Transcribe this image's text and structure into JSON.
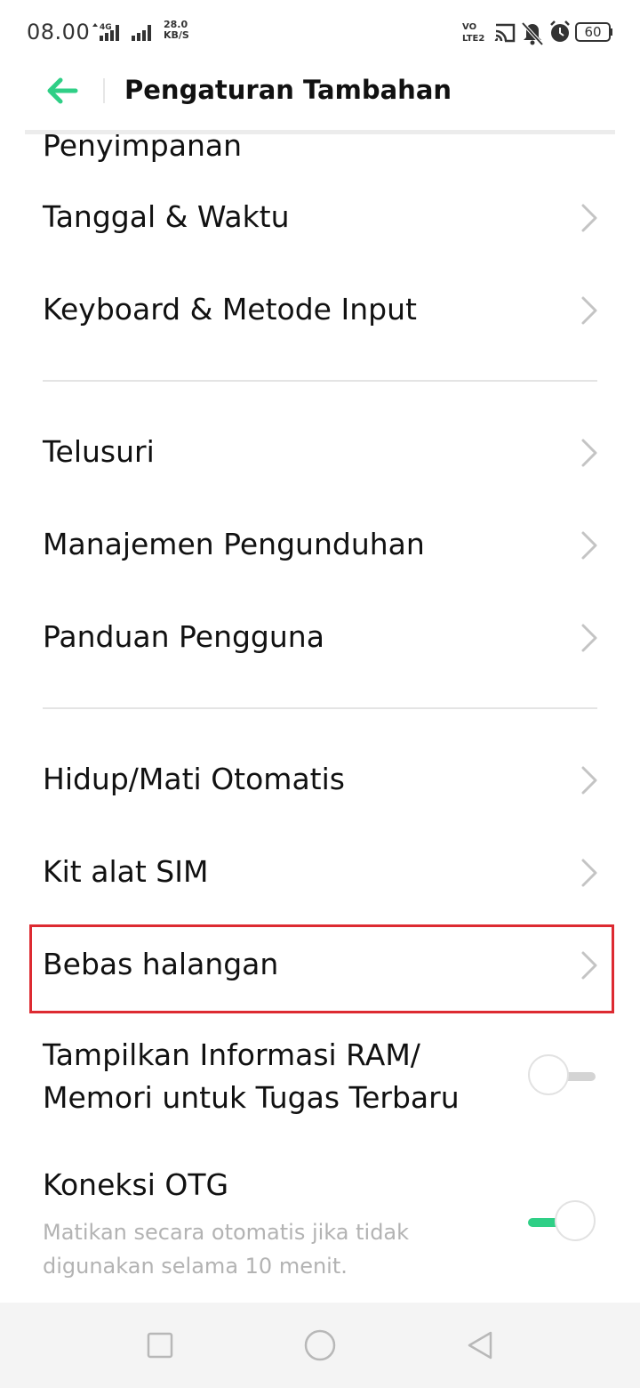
{
  "status_bar": {
    "time": "08.00",
    "network_type": "4G",
    "net_speed_value": "28.0",
    "net_speed_unit": "KB/S",
    "volte_label": "VO\nLTE2",
    "battery_level": "60"
  },
  "header": {
    "title": "Pengaturan Tambahan",
    "accent_color": "#2fcf86"
  },
  "list": {
    "partial_item": "Penyimpanan",
    "items": [
      {
        "label": "Tanggal & Waktu"
      },
      {
        "label": "Keyboard & Metode Input"
      },
      {
        "label": "Telusuri"
      },
      {
        "label": "Manajemen Pengunduhan"
      },
      {
        "label": "Panduan Pengguna"
      },
      {
        "label": "Hidup/Mati Otomatis"
      },
      {
        "label": "Kit alat SIM"
      },
      {
        "label": "Bebas halangan"
      }
    ],
    "ram_toggle": {
      "label": "Tampilkan Informasi RAM/\nMemori untuk Tugas Terbaru",
      "enabled": false
    },
    "otg": {
      "label": "Koneksi OTG",
      "subtitle": "Matikan secara otomatis jika tidak digunakan selama 10 menit.",
      "enabled": true
    }
  },
  "highlight_color": "#dd2a31",
  "nav_bar": {
    "buttons": [
      "recents-icon",
      "home-icon",
      "back-icon"
    ]
  }
}
